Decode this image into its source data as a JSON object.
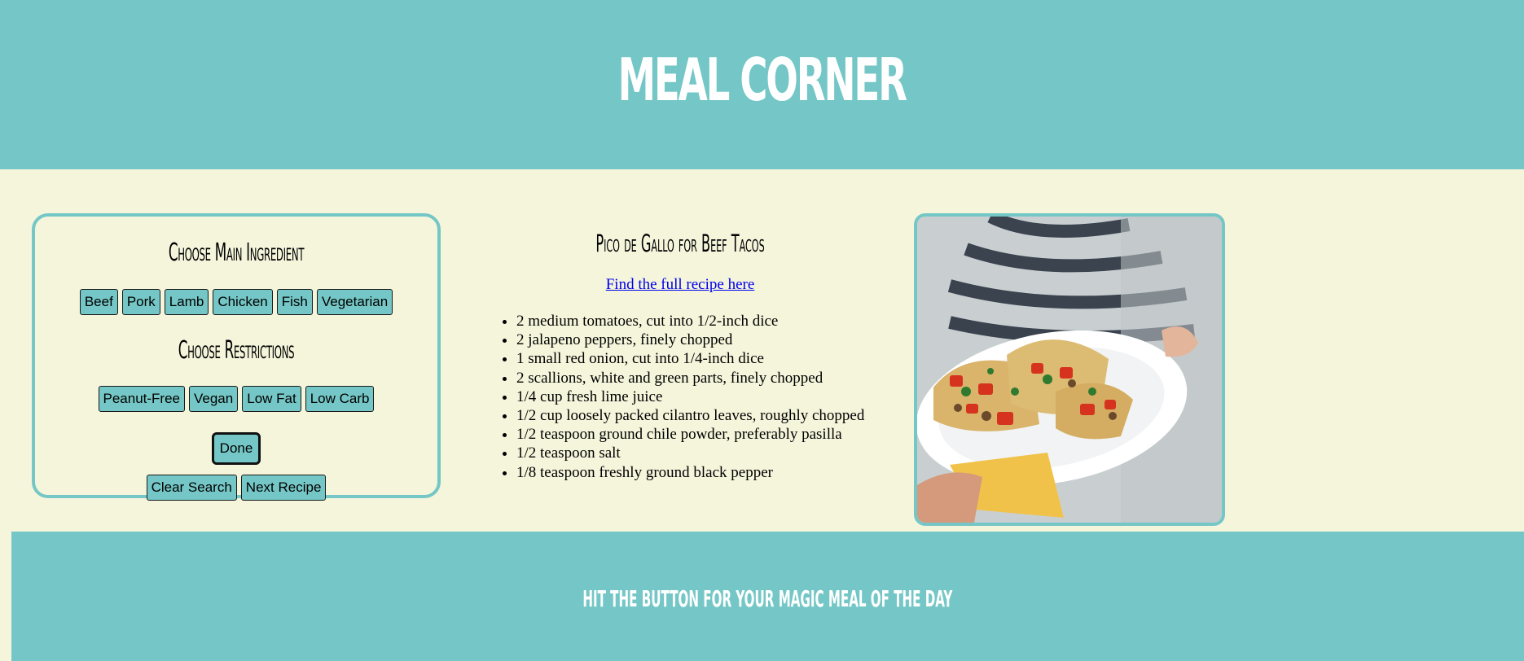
{
  "header": {
    "title": "MEAL CORNER"
  },
  "panel": {
    "main_heading": "Choose Main Ingredient",
    "ingredients": [
      "Beef",
      "Pork",
      "Lamb",
      "Chicken",
      "Fish",
      "Vegetarian"
    ],
    "restrictions_heading": "Choose Restrictions",
    "restrictions": [
      "Peanut-Free",
      "Vegan",
      "Low Fat",
      "Low Carb"
    ],
    "done_label": "Done",
    "clear_label": "Clear Search",
    "next_label": "Next Recipe"
  },
  "recipe": {
    "title": "Pico de Gallo for Beef Tacos",
    "link_text": "Find the full recipe here",
    "ingredients": [
      "2 medium tomatoes, cut into 1/2-inch dice",
      "2 jalapeno peppers, finely chopped",
      "1 small red onion, cut into 1/4-inch dice",
      "2 scallions, white and green parts, finely chopped",
      "1/4 cup fresh lime juice",
      "1/2 cup loosely packed cilantro leaves, roughly chopped",
      "1/2 teaspoon ground chile powder, preferably pasilla",
      "1/2 teaspoon salt",
      "1/8 teaspoon freshly ground black pepper"
    ]
  },
  "footer": {
    "text": "HIT THE BUTTON FOR YOUR MAGIC MEAL OF THE DAY"
  },
  "colors": {
    "accent": "#74c7c6",
    "background": "#f5f5dc",
    "link": "#0000ee"
  }
}
